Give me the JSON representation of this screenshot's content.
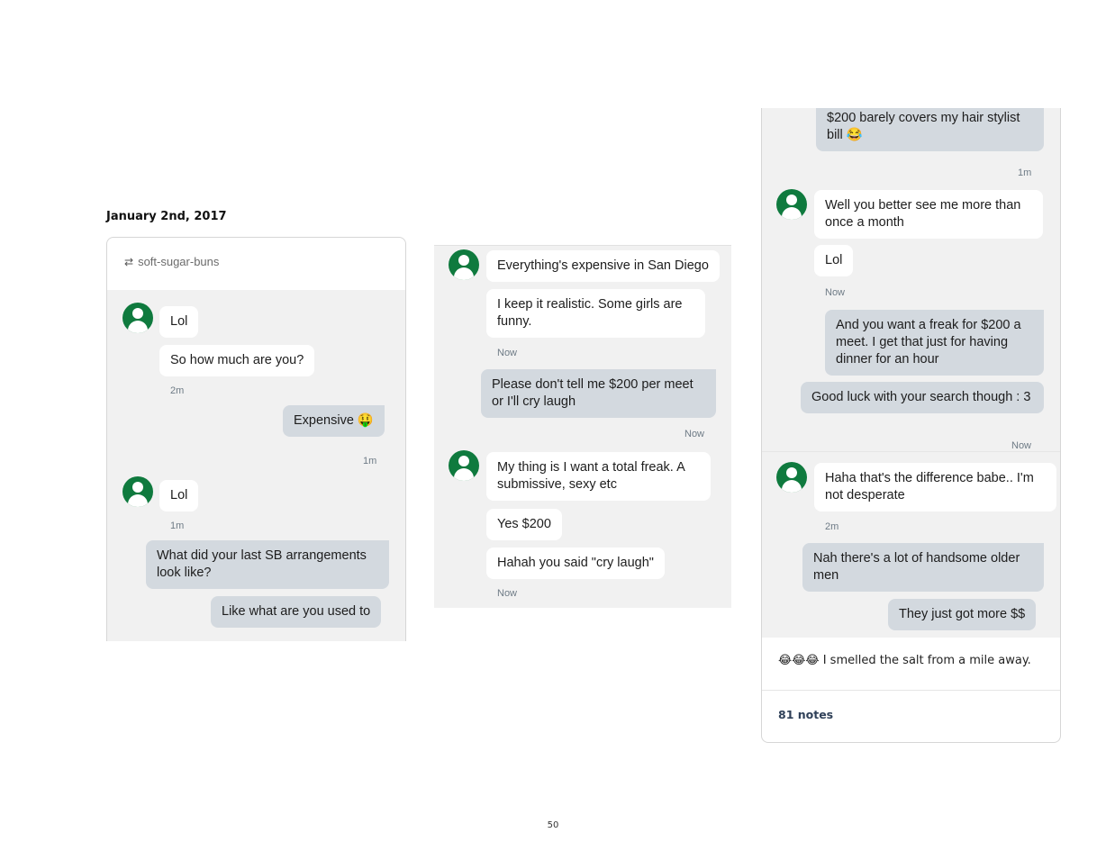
{
  "date": "January 2nd, 2017",
  "panel1": {
    "reblog_user": "soft-sugar-buns",
    "messages": [
      {
        "text": "Lol"
      },
      {
        "text": "So how much are you?"
      },
      {
        "time": "2m"
      },
      {
        "text": "Expensive 🤑"
      },
      {
        "time": "1m"
      },
      {
        "text": "Lol"
      },
      {
        "time": "1m"
      },
      {
        "text": "What did your last SB arrangements look like?"
      },
      {
        "text": "Like what are you used to"
      }
    ]
  },
  "panel2": {
    "messages": [
      {
        "text": "Everything's expensive in San Diego"
      },
      {
        "text": "I keep it realistic. Some girls are funny."
      },
      {
        "time": "Now"
      },
      {
        "text": "Please don't tell me $200 per meet or I'll cry laugh"
      },
      {
        "time": "Now"
      },
      {
        "text": "My thing is I want a total freak. A submissive, sexy etc"
      },
      {
        "text": "Yes $200"
      },
      {
        "text": "Hahah you said \"cry laugh\""
      },
      {
        "time": "Now"
      }
    ]
  },
  "panel3": {
    "messages": [
      {
        "text": "$200 barely covers my hair stylist bill 😂"
      },
      {
        "time": "1m"
      },
      {
        "text": "Well you better see me more than once a month"
      },
      {
        "text": "Lol"
      },
      {
        "time": "Now"
      },
      {
        "text": "And you want a freak for $200 a meet. I get that just for having dinner for an hour"
      },
      {
        "text": "Good luck with your search though : 3"
      },
      {
        "time": "Now"
      },
      {
        "text": "Haha that's the difference babe.. I'm not desperate"
      },
      {
        "time": "2m"
      },
      {
        "text": "Nah there's a lot of handsome older men"
      },
      {
        "text": "They just got more $$"
      }
    ],
    "caption": "😂😂😂 I smelled the salt from a mile away.",
    "notes": "81 notes"
  },
  "page_number": "50",
  "colors": {
    "avatar": "#0f7a3e",
    "incoming_bubble": "#ffffff",
    "outgoing_bubble": "#d3d9df",
    "thread_bg": "#f1f1f1"
  },
  "icons": {
    "reblog": "reblog-icon",
    "avatar": "user-avatar-icon"
  }
}
